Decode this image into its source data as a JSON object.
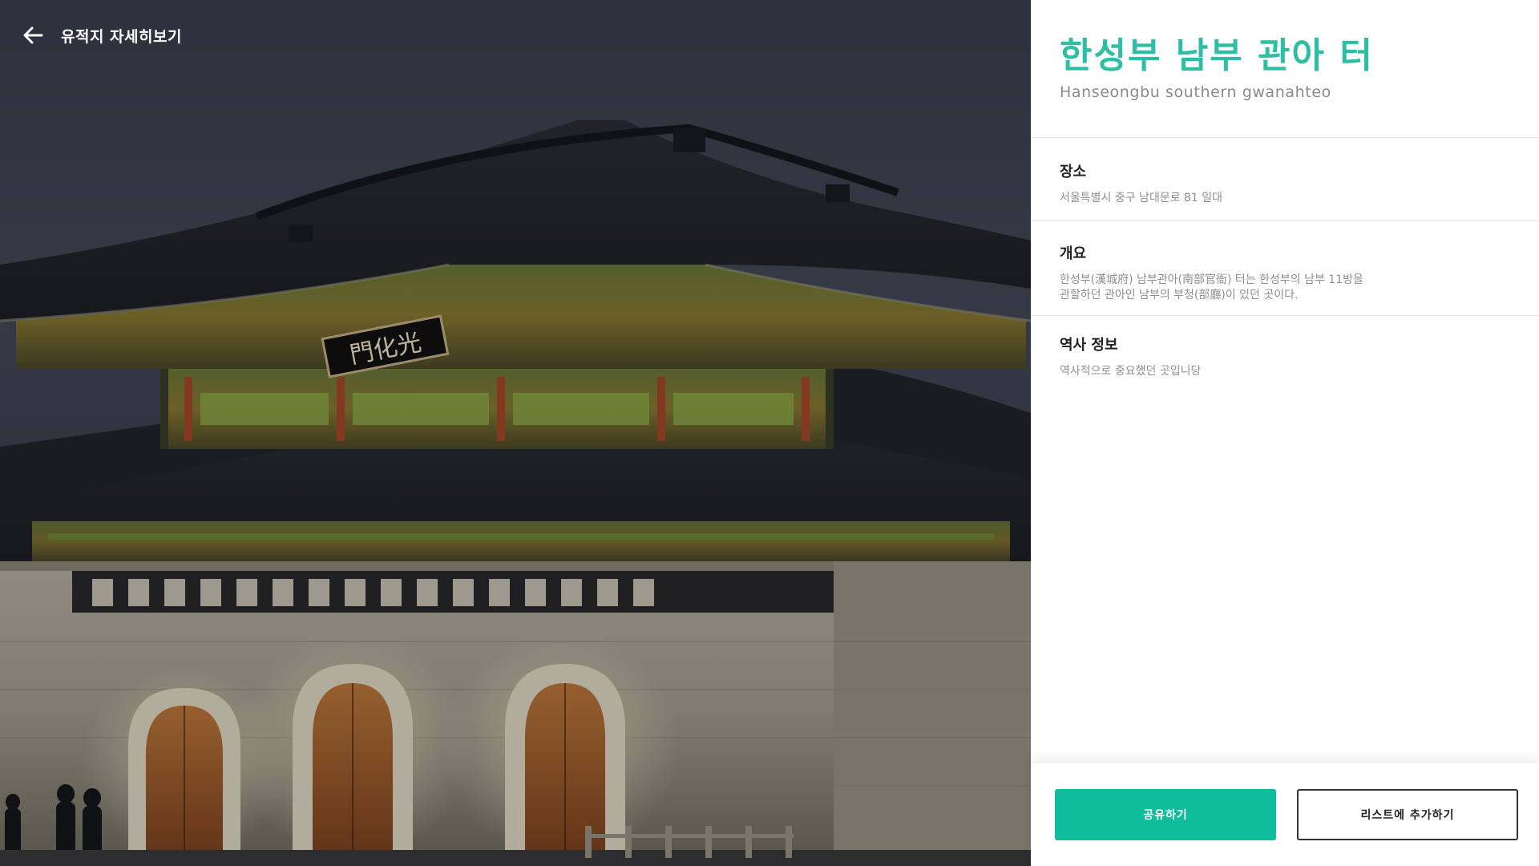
{
  "top_bar": {
    "back_icon": "arrow-left-icon",
    "title": "유적지 자세히보기"
  },
  "photo": {
    "signboard_text": "門化光"
  },
  "site": {
    "name_ko": "한성부 남부 관아 터",
    "name_en": "Hanseongbu southern gwanahteo"
  },
  "sections": {
    "location": {
      "title": "장소",
      "body": "서울특별시 중구 남대문로 81 일대"
    },
    "overview": {
      "title": "개요",
      "line1": "한성부(漢城府) 남부관아(南部官衙) 터는 한성부의 남부 11방을",
      "line2": "관할하던 관아인 남부의 부청(部廳)이 있던 곳이다."
    },
    "history": {
      "title": "역사 정보",
      "body": "역사적으로 중요했던 곳입니당"
    }
  },
  "actions": {
    "share_label": "공유하기",
    "add_list_label": "리스트에 추가하기"
  },
  "colors": {
    "accent": "#2cbfa3",
    "primary_button": "#0fbc9c"
  }
}
